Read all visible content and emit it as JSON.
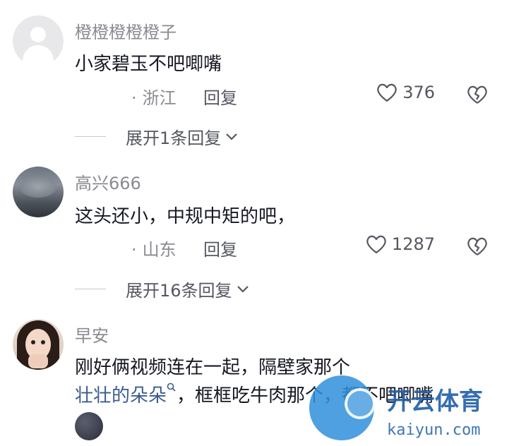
{
  "comments": [
    {
      "username": "橙橙橙橙橙子",
      "text": "小家碧玉不吧唧嘴",
      "location": "浙江",
      "reply_label": "回复",
      "likes": "376",
      "expand_label": "展开1条回复"
    },
    {
      "username": "高兴666",
      "text": "这头还小，中规中矩的吧，",
      "location": "山东",
      "reply_label": "回复",
      "likes": "1287",
      "expand_label": "展开16条回复"
    },
    {
      "username": "早安",
      "text_line1": "刚好俩视频连在一起，隔壁家那个",
      "mention": "壮壮的朵朵",
      "text_line2_rest": "，框框吃牛肉那个，都不吧唧嘴"
    }
  ],
  "icons": {
    "like": "heart-outline-icon",
    "dislike": "broken-heart-icon",
    "expand": "chevron-down-icon",
    "search": "search-icon"
  },
  "watermark": {
    "brand": "开云体育",
    "url": "kaiyun.com"
  },
  "colors": {
    "link": "#3a5c8f",
    "muted": "#8a8b91",
    "text": "#161823"
  }
}
